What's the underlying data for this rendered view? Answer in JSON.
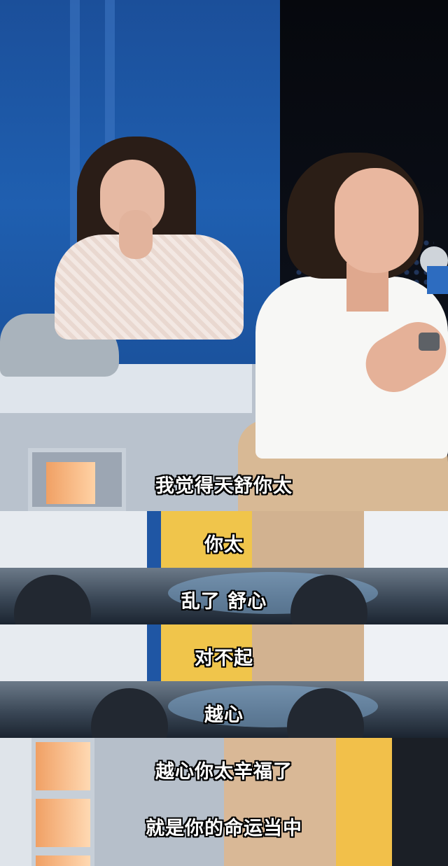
{
  "subtitles": {
    "line_1": "我觉得天舒你太",
    "line_2": "你太",
    "line_3": "乱了 舒心",
    "line_4": "对不起",
    "line_5": "越心",
    "line_6": "越心你太辛福了",
    "line_7": "就是你的命运当中"
  },
  "colors": {
    "stage_blue": "#1f5fb0",
    "shirt_white": "#f7f7f5",
    "chair_yellow": "#f0c54b",
    "subtitle_text": "#ffffff"
  }
}
